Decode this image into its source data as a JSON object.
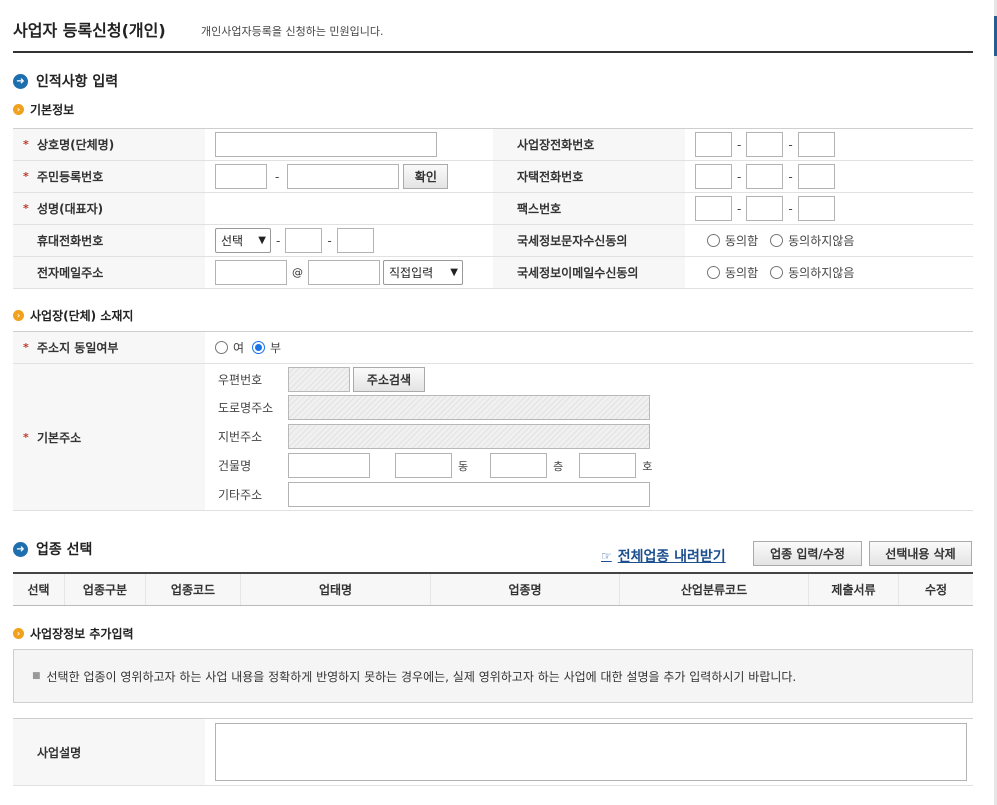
{
  "header": {
    "title": "사업자 등록신청(개인)",
    "subtitle": "개인사업자등록을 신청하는 민원입니다."
  },
  "section_personal": {
    "title": "인적사항 입력",
    "basic": {
      "title": "기본정보",
      "rows": [
        {
          "left_label": "상호명(단체명)",
          "right_label": "사업장전화번호"
        },
        {
          "left_label": "주민등록번호",
          "right_label": "자택전화번호",
          "confirm_button": "확인"
        },
        {
          "left_label": "성명(대표자)",
          "right_label": "팩스번호"
        },
        {
          "left_label": "휴대전화번호",
          "right_label": "국세정보문자수신동의",
          "select_value": "선택"
        },
        {
          "left_label": "전자메일주소",
          "right_label": "국세정보이메일수신동의",
          "at_sign": "@",
          "select_value": "직접입력"
        }
      ],
      "agree_label": "동의함",
      "disagree_label": "동의하지않음",
      "dash": "-"
    }
  },
  "section_location": {
    "title": "사업장(단체) 소재지",
    "same_address_label": "주소지 동일여부",
    "same_yes": "여",
    "same_no": "부",
    "same_selected": "부",
    "basic_address_label": "기본주소",
    "postal_label": "우편번호",
    "search_button": "주소검색",
    "road_label": "도로명주소",
    "lot_label": "지번주소",
    "building_label": "건물명",
    "dong": "동",
    "floor": "층",
    "ho": "호",
    "other_label": "기타주소"
  },
  "section_industry": {
    "title": "업종 선택",
    "download_link": "전체업종 내려받기",
    "input_button": "업종 입력/수정",
    "delete_button": "선택내용 삭제",
    "columns": [
      "선택",
      "업종구분",
      "업종코드",
      "업태명",
      "업종명",
      "산업분류코드",
      "제출서류",
      "수정"
    ]
  },
  "section_extra": {
    "title": "사업장정보 추가입력",
    "notice": "선택한 업종이 영위하고자 하는 사업 내용을 정확하게 반영하지 못하는 경우에는, 실제 영위하고자 하는 사업에 대한 설명을 추가 입력하시기 바랍니다.",
    "desc_label": "사업설명"
  },
  "icons": {
    "section_icon": "arrow-right-circle-icon",
    "subsection_icon": "orange-bullet-icon",
    "link_icon": "pointing-hand-icon"
  },
  "colors": {
    "required": "#c0392b",
    "link": "#1c4f8f",
    "section_icon": "#1d6fae",
    "sub_icon": "#f0a11d"
  }
}
